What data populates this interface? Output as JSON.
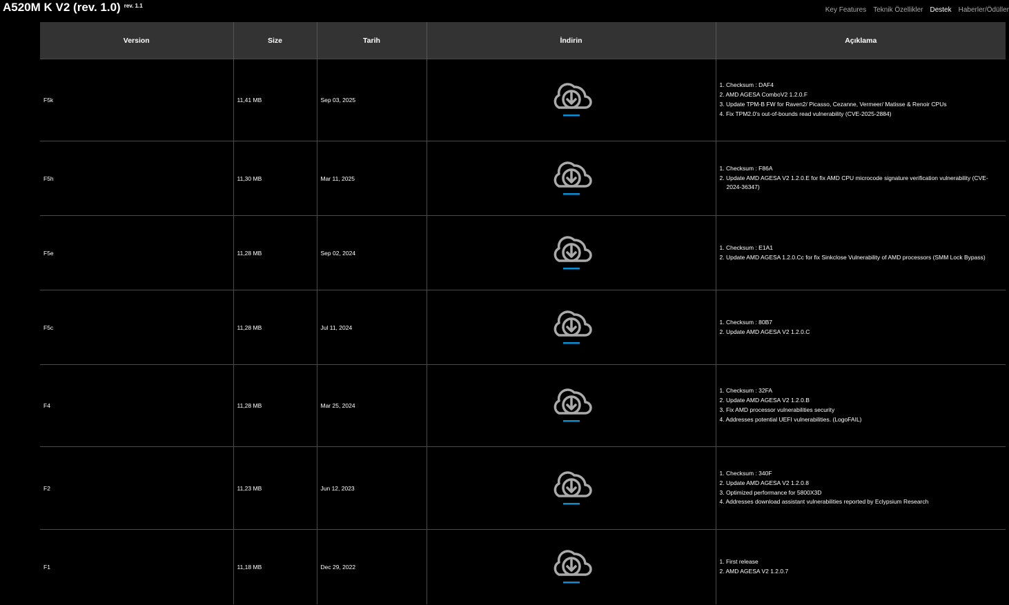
{
  "header": {
    "title": "A520M K V2 (rev. 1.0)",
    "rev_badge": "rev. 1.1",
    "nav": [
      "Key Features",
      "Teknik Özellikler",
      "Destek",
      "Haberler/Ödüller"
    ],
    "nav_active": "Destek"
  },
  "table": {
    "columns": [
      "Version",
      "Size",
      "Tarih",
      "İndirin",
      "Açıklama"
    ],
    "rows": [
      {
        "version": "F5k",
        "size": "11,41 MB",
        "date": "Sep 03, 2025",
        "notes": [
          "1. Checksum : DAF4",
          "2. AMD AGESA ComboV2 1.2.0.F",
          "3. Update TPM-B FW for Raven2/ Picasso, Cezanne, Vermeer/ Matisse & Renoir CPUs",
          "4. Fix TPM2.0's out-of-bounds read vulnerability (CVE-2025-2884)"
        ]
      },
      {
        "version": "F5h",
        "size": "11,30 MB",
        "date": "Mar 11, 2025",
        "notes": [
          "1. Checksum : F86A",
          "2. Update AMD AGESA V2 1.2.0.E for fix AMD CPU microcode signature verification vulnerability (CVE-2024-36347)"
        ]
      },
      {
        "version": "F5e",
        "size": "11,28 MB",
        "date": "Sep 02, 2024",
        "notes": [
          "1. Checksum : E1A1",
          "2. Update AMD AGESA 1.2.0.Cc for fix Sinkclose Vulnerability of AMD processors (SMM Lock Bypass)"
        ]
      },
      {
        "version": "F5c",
        "size": "11,28 MB",
        "date": "Jul 11, 2024",
        "notes": [
          "1. Checksum : 80B7",
          "2. Update AMD AGESA V2 1.2.0.C"
        ]
      },
      {
        "version": "F4",
        "size": "11,28 MB",
        "date": "Mar 25, 2024",
        "notes": [
          "1. Checksum : 32FA",
          "2. Update AMD AGESA V2 1.2.0.B",
          "3. Fix AMD processor vulnerabilities security",
          "4. Addresses potential UEFI vulnerabilities. (LogoFAIL)"
        ]
      },
      {
        "version": "F2",
        "size": "11,23 MB",
        "date": "Jun 12, 2023",
        "notes": [
          "1. Checksum : 340F",
          "2. Update AMD AGESA V2 1.2.0.8",
          "3. Optimized performance for 5800X3D",
          "4. Addresses download assistant vulnerabilities reported by Eclypsium Research"
        ]
      },
      {
        "version": "F1",
        "size": "11,18 MB",
        "date": "Dec 29, 2022",
        "notes": [
          "1. First release",
          "2. AMD AGESA V2 1.2.0.7"
        ]
      }
    ]
  },
  "icons": {
    "download": "cloud-download-icon"
  },
  "colors": {
    "accent": "#0a8fd6",
    "icon_gray": "#aaaaaa",
    "header_bg": "#333333"
  }
}
